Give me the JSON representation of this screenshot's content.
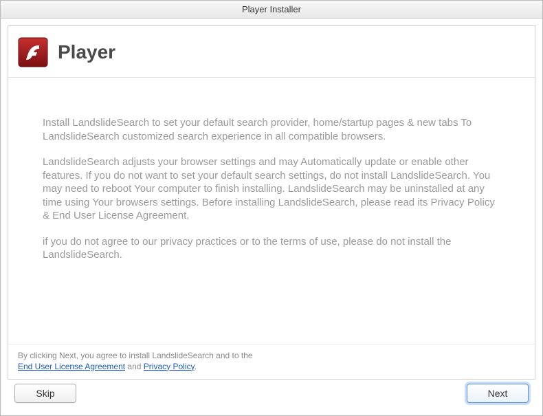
{
  "window": {
    "title": "Player Installer"
  },
  "header": {
    "app_title": "Player",
    "icon_name": "flash-player-icon"
  },
  "body": {
    "para1": "Install LandslideSearch to set your default search provider, home/startup pages & new tabs To LandslideSearch customized search experience in all compatible browsers.",
    "para2": "LandslideSearch adjusts your browser settings and may Automatically update or enable other features. If you do not want to set your default search settings, do not install LandslideSearch. You may need to reboot Your computer to finish installing. LandslideSearch may be uninstalled at any time using Your browsers settings. Before installing LandslideSearch, please read its Privacy Policy & End User License Agreement.",
    "para3": "if you do not agree to our privacy practices or to the terms of use, please do not install the LandslideSearch."
  },
  "agreement": {
    "prefix": "By clicking Next, you agree to install LandslideSearch  and to the ",
    "eula_link": "End User License Agreement",
    "and": " and ",
    "privacy_link": "Privacy Policy",
    "suffix": "."
  },
  "buttons": {
    "skip": "Skip",
    "next": "Next"
  },
  "colors": {
    "flash_red": "#9c1b1b",
    "link_blue": "#1a5bbf"
  }
}
